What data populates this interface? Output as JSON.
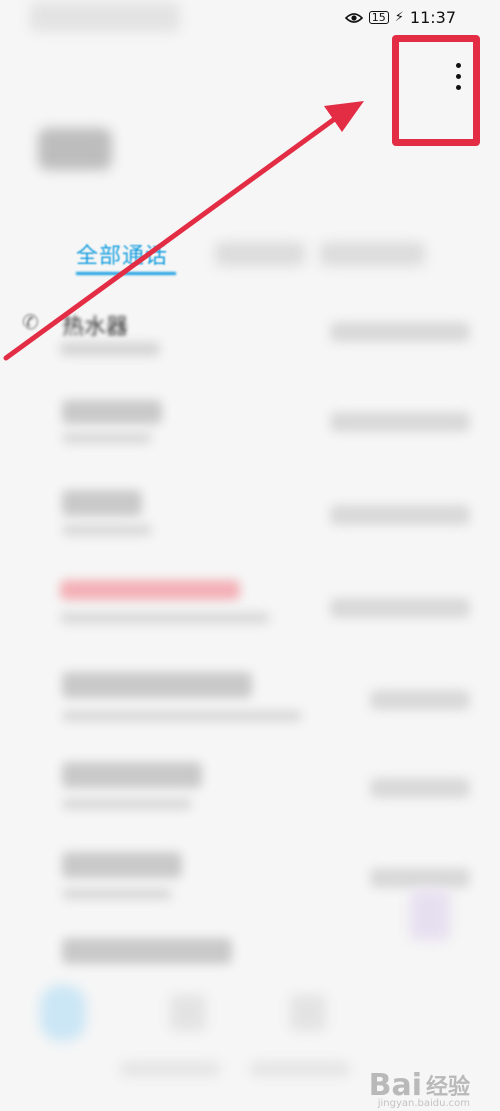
{
  "status_bar": {
    "battery": "15",
    "time": "11:37",
    "icons": [
      "eye-icon",
      "charging-icon"
    ]
  },
  "header": {
    "more_icon": "more-vertical-icon"
  },
  "tabs": [
    {
      "label": "全部通话"
    }
  ],
  "call_list": {
    "first_row_name": "热水器"
  },
  "annotation": {
    "highlight_color": "#e32d45",
    "arrow_color": "#e32d45"
  },
  "watermark": {
    "logo": "Bai",
    "brand_cn": "经验",
    "url": "jingyan.baidu.com"
  }
}
